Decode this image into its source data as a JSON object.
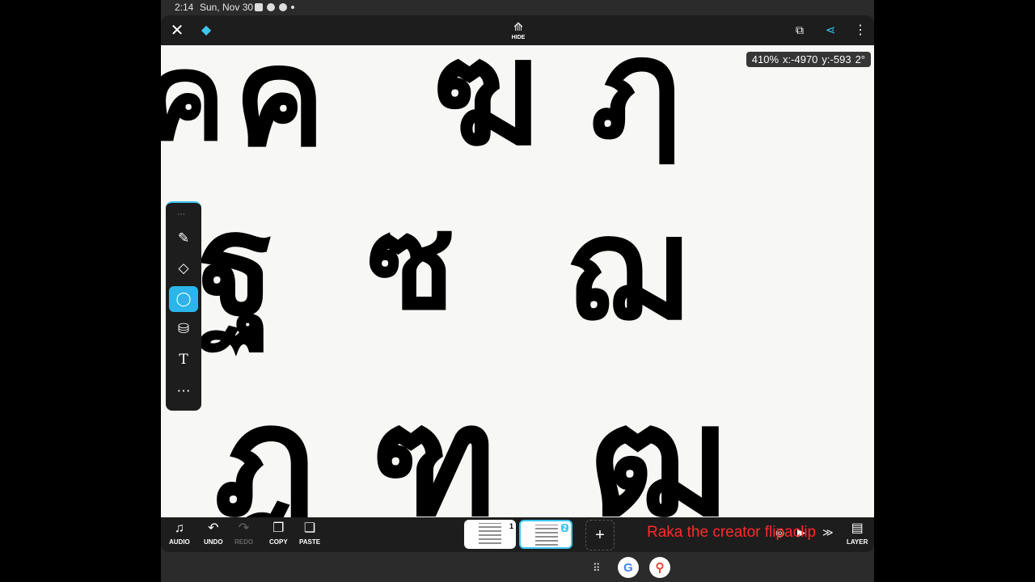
{
  "status_bar": {
    "time": "2:14",
    "date": "Sun, Nov 30"
  },
  "topbar": {
    "hide_label": "HIDE",
    "icons": [
      "close-icon",
      "gem-icon",
      "hide-icon",
      "fit-screen-icon",
      "share-icon",
      "more-icon"
    ]
  },
  "canvas": {
    "zoom": "410%",
    "x": "x:-4970",
    "y": "y:-593",
    "rotation": "2°",
    "glyphs": [
      "ค",
      "ฅ",
      "ฆ",
      "ฎ",
      "ซ",
      "ฌ",
      "ฐ",
      "ฑ",
      "ฒ",
      "ฦ"
    ]
  },
  "tools": [
    "brush-tool",
    "eraser-tool",
    "lasso-tool",
    "fill-tool",
    "text-tool",
    "more-tools"
  ],
  "bottombar": {
    "audio": "AUDIO",
    "undo": "UNDO",
    "redo": "REDO",
    "copy": "COPY",
    "paste": "PASTE",
    "layer": "LAYER",
    "frames": [
      {
        "number": "1"
      },
      {
        "number": "2"
      }
    ],
    "add": "+"
  },
  "watermark": "Raka the creator flipaclip",
  "accent": "#3fc5f0"
}
